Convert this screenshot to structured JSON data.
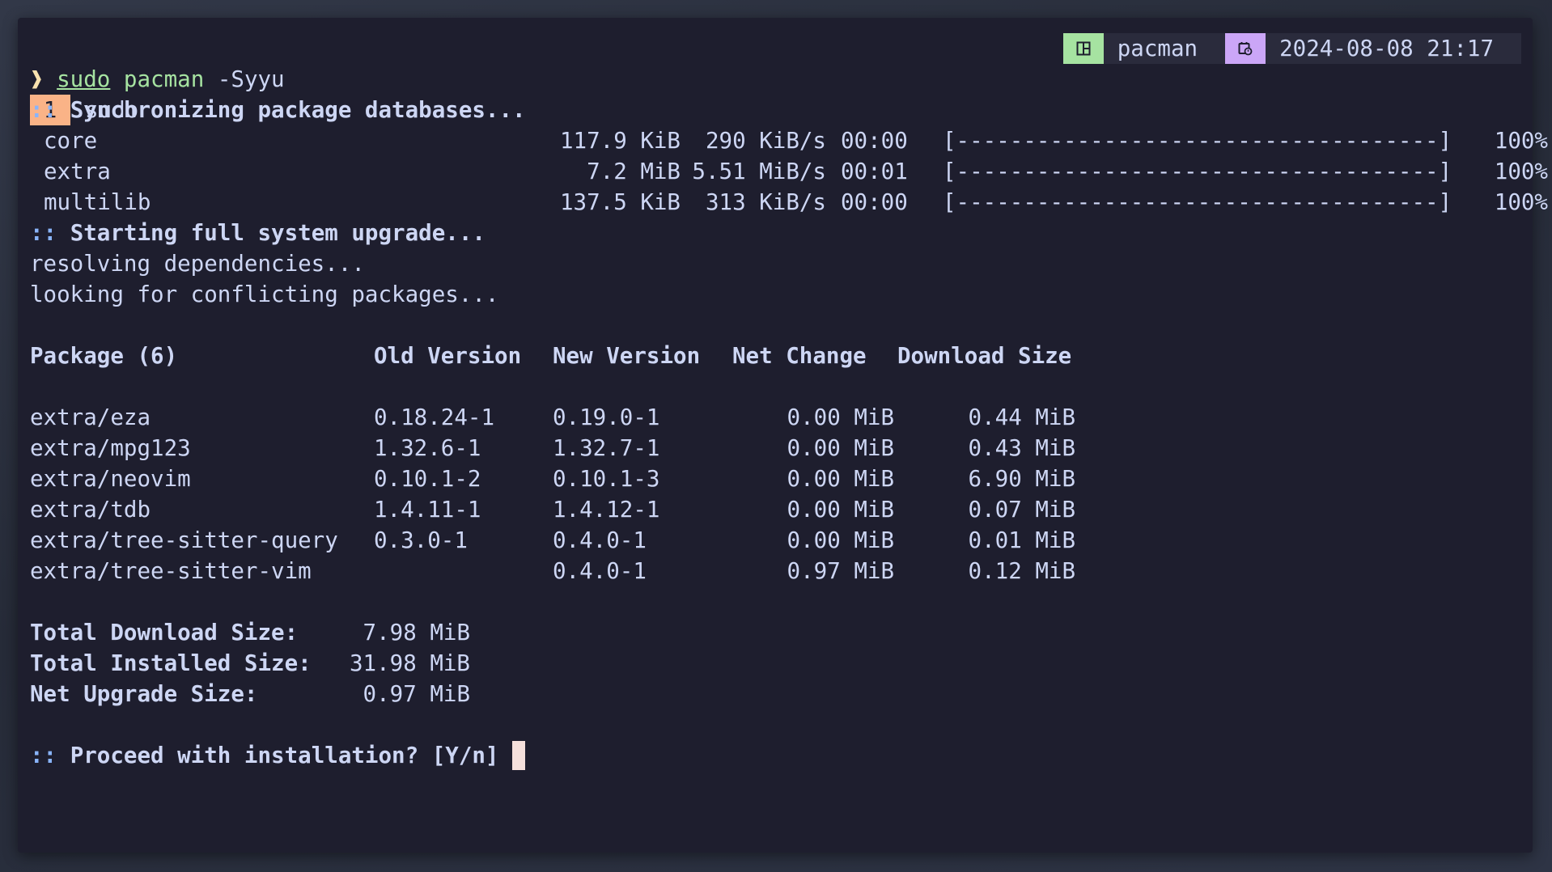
{
  "statusbar": {
    "workspace_number": "1",
    "workspace_name": "sudo",
    "app_icon": "layout-icon",
    "app_name": "pacman",
    "clock_icon": "calendar-clock-icon",
    "datetime": "2024-08-08 21:17"
  },
  "command": {
    "prompt": "❱",
    "sudo": "sudo",
    "program": "pacman",
    "args": "-Syyu"
  },
  "sync": {
    "header_prefix": "::",
    "header": "Synchronizing package databases...",
    "repos": [
      {
        "name": "core",
        "size": "117.9 KiB",
        "speed": "290 KiB/s",
        "time": "00:00",
        "bar": "[------------------------------------]",
        "percent": "100%"
      },
      {
        "name": "extra",
        "size": "7.2 MiB",
        "speed": "5.51 MiB/s",
        "time": "00:01",
        "bar": "[------------------------------------]",
        "percent": "100%"
      },
      {
        "name": "multilib",
        "size": "137.5 KiB",
        "speed": "313 KiB/s",
        "time": "00:00",
        "bar": "[------------------------------------]",
        "percent": "100%"
      }
    ]
  },
  "upgrade": {
    "header_prefix": "::",
    "header": "Starting full system upgrade...",
    "resolving": "resolving dependencies...",
    "conflicts": "looking for conflicting packages..."
  },
  "table": {
    "headers": [
      "Package (6)",
      "Old Version",
      "New Version",
      "Net Change",
      "Download Size"
    ],
    "rows": [
      {
        "package": "extra/eza",
        "old": "0.18.24-1",
        "new": "0.19.0-1",
        "net": "0.00 MiB",
        "download": "0.44 MiB"
      },
      {
        "package": "extra/mpg123",
        "old": "1.32.6-1",
        "new": "1.32.7-1",
        "net": "0.00 MiB",
        "download": "0.43 MiB"
      },
      {
        "package": "extra/neovim",
        "old": "0.10.1-2",
        "new": "0.10.1-3",
        "net": "0.00 MiB",
        "download": "6.90 MiB"
      },
      {
        "package": "extra/tdb",
        "old": "1.4.11-1",
        "new": "1.4.12-1",
        "net": "0.00 MiB",
        "download": "0.07 MiB"
      },
      {
        "package": "extra/tree-sitter-query",
        "old": "0.3.0-1",
        "new": "0.4.0-1",
        "net": "0.00 MiB",
        "download": "0.01 MiB"
      },
      {
        "package": "extra/tree-sitter-vim",
        "old": "",
        "new": "0.4.0-1",
        "net": "0.97 MiB",
        "download": "0.12 MiB"
      }
    ]
  },
  "totals": [
    {
      "label": "Total Download Size:",
      "value": "7.98 MiB"
    },
    {
      "label": "Total Installed Size:",
      "value": "31.98 MiB"
    },
    {
      "label": "Net Upgrade Size:",
      "value": "0.97 MiB"
    }
  ],
  "proceed": {
    "prefix": "::",
    "question": "Proceed with installation? [Y/n]"
  },
  "colors": {
    "background": "#1e1e2e",
    "foreground": "#cdd6f4",
    "workspace_badge": "#fab387",
    "app_badge": "#a6e3a1",
    "clock_badge": "#cba6f7",
    "prompt": "#f9e2af",
    "command": "#a6e3a1",
    "cursor": "#f5e0dc"
  }
}
